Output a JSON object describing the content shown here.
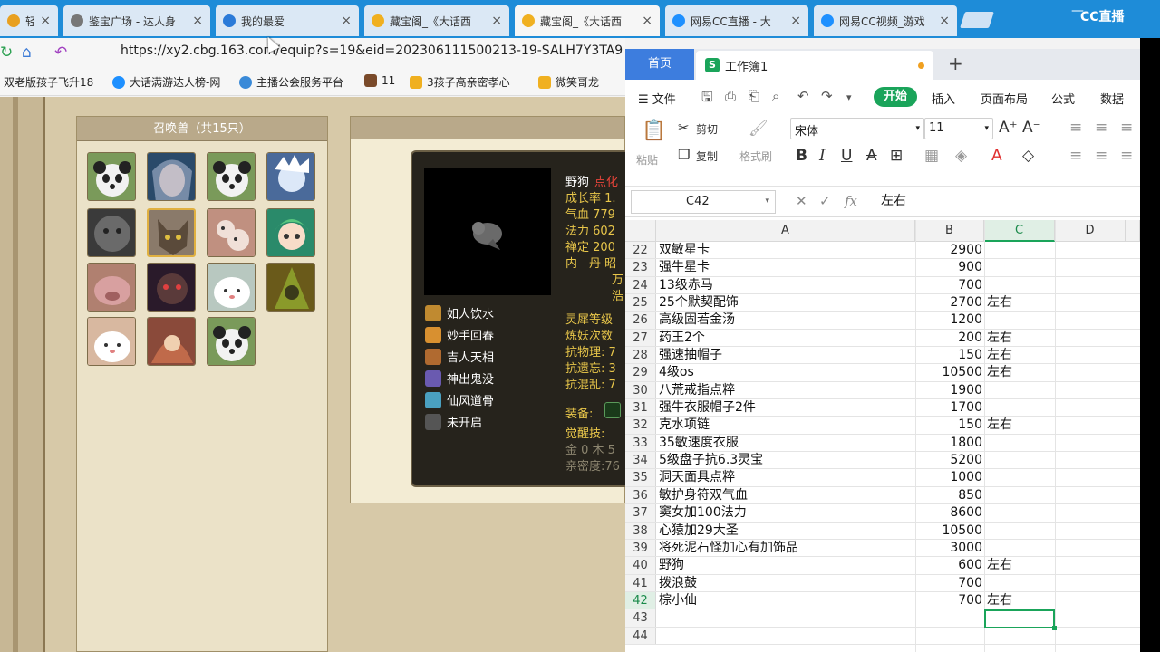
{
  "browser": {
    "tabs": [
      {
        "label": "轻快...",
        "icon_color": "#e8a020"
      },
      {
        "label": "鉴宝广场 - 达人身",
        "icon_color": "#666666"
      },
      {
        "label": "我的最爱",
        "icon_color": "#2a7ad8"
      },
      {
        "label": "藏宝阁_《大话西",
        "icon_color": "#f0b020"
      },
      {
        "label": "藏宝阁_《大话西",
        "icon_color": "#f0b020"
      },
      {
        "label": "网易CC直播 - 大",
        "icon_color": "#1e90ff"
      },
      {
        "label": "网易CC视频_游戏",
        "icon_color": "#1e90ff"
      }
    ],
    "url": "https://xy2.cbg.163.com/equip?s=19&eid=202306111500213-19-SALH7Y3TA9",
    "bookmarks": [
      "双老版孩子飞升18",
      "大话满游达人榜-网",
      "主播公会服务平台",
      "11",
      "3孩子高亲密孝心",
      "微笑哥龙"
    ],
    "cc_brand": "CC直播"
  },
  "game": {
    "pets_title": "召唤兽（共15只）",
    "pet_name": "野狗",
    "pet_name_suffix": "点化",
    "stats": [
      "成长率 1.",
      "气血 779",
      "法力 602",
      "禅定 200",
      "内　丹 昭",
      "万",
      "浩"
    ],
    "stats2": [
      "灵犀等级",
      "炼妖次数",
      "抗物理: 7",
      "抗遗忘: 3",
      "抗混乱: 7"
    ],
    "equip_label": "装备:",
    "awaken_label": "觉醒技:",
    "elements": "金 0 木 5",
    "intimacy": "亲密度:76",
    "skills": [
      {
        "label": "如人饮水",
        "color": "#c08a30"
      },
      {
        "label": "妙手回春",
        "color": "#d89030"
      },
      {
        "label": "吉人天相",
        "color": "#b06a30"
      },
      {
        "label": "神出鬼没",
        "color": "#6a5ab0"
      },
      {
        "label": "仙风道骨",
        "color": "#4aa0c0"
      },
      {
        "label": "未开启",
        "color": "#555555"
      }
    ]
  },
  "wps": {
    "home_tab": "首页",
    "doc_tab": "工作簿1",
    "doc_icon": "S",
    "menu": [
      "文件",
      "开始",
      "插入",
      "页面布局",
      "公式",
      "数据"
    ],
    "ribbon": {
      "paste": "粘贴",
      "cut": "剪切",
      "copy": "复制",
      "format_painter": "格式刷",
      "font_name": "宋体",
      "font_size": "11"
    },
    "name_box": "C42",
    "formula_value": "左右",
    "columns": [
      "A",
      "B",
      "C",
      "D"
    ],
    "rows": [
      {
        "n": "22",
        "a": "双敏星卡",
        "b": "2900",
        "c": ""
      },
      {
        "n": "23",
        "a": "强牛星卡",
        "b": "900",
        "c": ""
      },
      {
        "n": "24",
        "a": "13级赤马",
        "b": "700",
        "c": ""
      },
      {
        "n": "25",
        "a": "25个默契配饰",
        "b": "2700",
        "c": "左右"
      },
      {
        "n": "26",
        "a": "高级固若金汤",
        "b": "1200",
        "c": ""
      },
      {
        "n": "27",
        "a": "药王2个",
        "b": "200",
        "c": "左右"
      },
      {
        "n": "28",
        "a": "强速抽帽子",
        "b": "150",
        "c": "左右"
      },
      {
        "n": "29",
        "a": "4级os",
        "b": "10500",
        "c": "左右"
      },
      {
        "n": "30",
        "a": "八荒戒指点粹",
        "b": "1900",
        "c": ""
      },
      {
        "n": "31",
        "a": "强牛衣服帽子2件",
        "b": "1700",
        "c": ""
      },
      {
        "n": "32",
        "a": "克水项链",
        "b": "150",
        "c": "左右"
      },
      {
        "n": "33",
        "a": "35敏速度衣服",
        "b": "1800",
        "c": ""
      },
      {
        "n": "34",
        "a": "5级盘子抗6.3灵宝",
        "b": "5200",
        "c": ""
      },
      {
        "n": "35",
        "a": "洞天面具点粹",
        "b": "1000",
        "c": ""
      },
      {
        "n": "36",
        "a": "敏护身符双气血",
        "b": "850",
        "c": ""
      },
      {
        "n": "37",
        "a": "窦女加100法力",
        "b": "8600",
        "c": ""
      },
      {
        "n": "38",
        "a": "心猿加29大圣",
        "b": "10500",
        "c": ""
      },
      {
        "n": "39",
        "a": "将死泥石怪加心有加饰品",
        "b": "3000",
        "c": ""
      },
      {
        "n": "40",
        "a": "野狗",
        "b": "600",
        "c": "左右"
      },
      {
        "n": "41",
        "a": "拨浪鼓",
        "b": "700",
        "c": ""
      },
      {
        "n": "42",
        "a": "棕小仙",
        "b": "700",
        "c": "左右"
      },
      {
        "n": "43",
        "a": "",
        "b": "",
        "c": ""
      },
      {
        "n": "44",
        "a": "",
        "b": "",
        "c": ""
      }
    ],
    "selected_row": "42"
  }
}
